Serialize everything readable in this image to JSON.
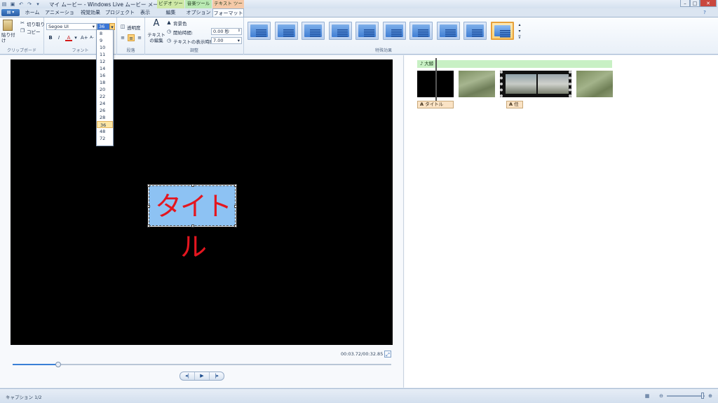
{
  "window": {
    "title": "マイ ムービー - Windows Live ムービー メーカー",
    "minimize": "–",
    "maximize": "□",
    "close": "✕"
  },
  "context_groups": {
    "video_tools": "ビデオ ツール",
    "music_tools": "音楽ツール",
    "text_tools": "テキスト ツール"
  },
  "tabs": {
    "home": "ホーム",
    "animation": "アニメーション",
    "visual_effects": "視覚効果",
    "project": "プロジェクト",
    "view": "表示",
    "edit": "編集",
    "options": "オプション",
    "format": "フォーマット"
  },
  "clipboard": {
    "paste": "貼り付け",
    "cut": "切り取り",
    "copy": "コピー",
    "group_label": "クリップボード"
  },
  "font": {
    "family": "Segoe UI",
    "size": "36",
    "bold": "B",
    "italic": "I",
    "color": "A",
    "grow": "A+",
    "shrink": "A-",
    "group_label": "フォント"
  },
  "paragraph": {
    "transparency": "透明度",
    "group_label": "段落"
  },
  "adjust": {
    "edit_text": "テキストの編集",
    "bg_color": "背景色",
    "start_time_label": "開始時間:",
    "start_time_value": "0.00 秒",
    "duration_label": "テキストの表示時間:",
    "duration_value": "7.00",
    "group_label": "調整"
  },
  "effects": {
    "group_label": "特殊効果",
    "selected_index": 9
  },
  "font_sizes": [
    "8",
    "9",
    "10",
    "11",
    "12",
    "14",
    "16",
    "18",
    "20",
    "22",
    "24",
    "26",
    "28",
    "36",
    "48",
    "72"
  ],
  "preview": {
    "caption_text": "タイトル",
    "timecode": "00:03.72/00:32.85",
    "progress": 0.12
  },
  "storyboard": {
    "music_label": "大鯨",
    "caption1": "タイトル",
    "caption2": "任"
  },
  "status": {
    "caption_count": "キャプション 1/2"
  }
}
